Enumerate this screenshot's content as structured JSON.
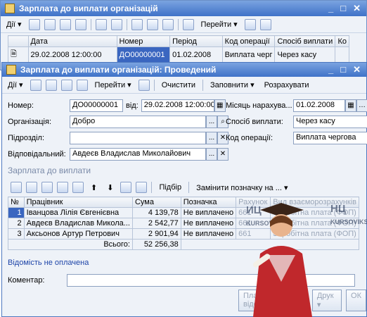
{
  "back": {
    "title": "Зарплата до виплати організацій",
    "toolbar": {
      "actions": "Дії",
      "goto": "Перейти"
    },
    "columns": [
      "Дата",
      "Номер",
      "Період",
      "Код операції",
      "Спосіб виплати",
      "Ко"
    ],
    "row": {
      "date": "29.02.2008 12:00:00",
      "number": "ДО00000001",
      "period": "01.02.2008",
      "op": "Виплата черг",
      "method": "Через касу",
      "ko": ""
    }
  },
  "front": {
    "title": "Зарплата до виплати організацій: Проведений",
    "toolbar": {
      "actions": "Дії",
      "goto": "Перейти",
      "clear": "Очистити",
      "fill": "Заповнити",
      "calc": "Розрахувати"
    },
    "form": {
      "number_label": "Номер:",
      "number": "ДО00000001",
      "from_label": "від:",
      "date": "29.02.2008 12:00:00",
      "month_label": "Місяць нарахува...",
      "month": "01.02.2008",
      "org_label": "Організація:",
      "org": "Добро",
      "method_label": "Спосіб виплати:",
      "method": "Через касу",
      "dept_label": "Підрозділ:",
      "dept": "",
      "op_label": "Код операції:",
      "op": "Виплата чергова",
      "resp_label": "Відповідальний:",
      "resp": "Авдеєв Владислав Миколайович"
    },
    "section": "Зарплата до виплати",
    "grid_toolbar": {
      "select": "Підбір",
      "replace": "Замінити позначку на ..."
    },
    "columns": [
      "№",
      "Працівник",
      "Сума",
      "Позначка",
      "Рахунок",
      "Вид взаєморозрахунків"
    ],
    "rows": [
      {
        "n": "1",
        "name": "Іванцова Лілія Євгенієвна",
        "sum": "4 139,78",
        "mark": "Не виплачено",
        "acc": "661",
        "kind": "Заробітна плата (ФОП)"
      },
      {
        "n": "2",
        "name": "Авдеєв Владислав Микола...",
        "sum": "2 542,77",
        "mark": "Не виплачено",
        "acc": "661",
        "kind": "Заробітна плата (ФОП)"
      },
      {
        "n": "3",
        "name": "Аксьонов Артур Петрович",
        "sum": "2 901,94",
        "mark": "Не виплачено",
        "acc": "661",
        "kind": "Заробітна плата (ФОП)"
      }
    ],
    "total_label": "Всього:",
    "total": "52 256,38",
    "status": "Відомість не оплачена",
    "comment_label": "Коментар:",
    "bottom": {
      "statement": "Платіжна відомість",
      "print": "Друк",
      "ok": "ОК"
    }
  },
  "watermark": {
    "left": "ИЦ",
    "left_sub": "KURSOVIKS",
    "right": "НЦ",
    "right_sub": "KURSOVIKS"
  }
}
